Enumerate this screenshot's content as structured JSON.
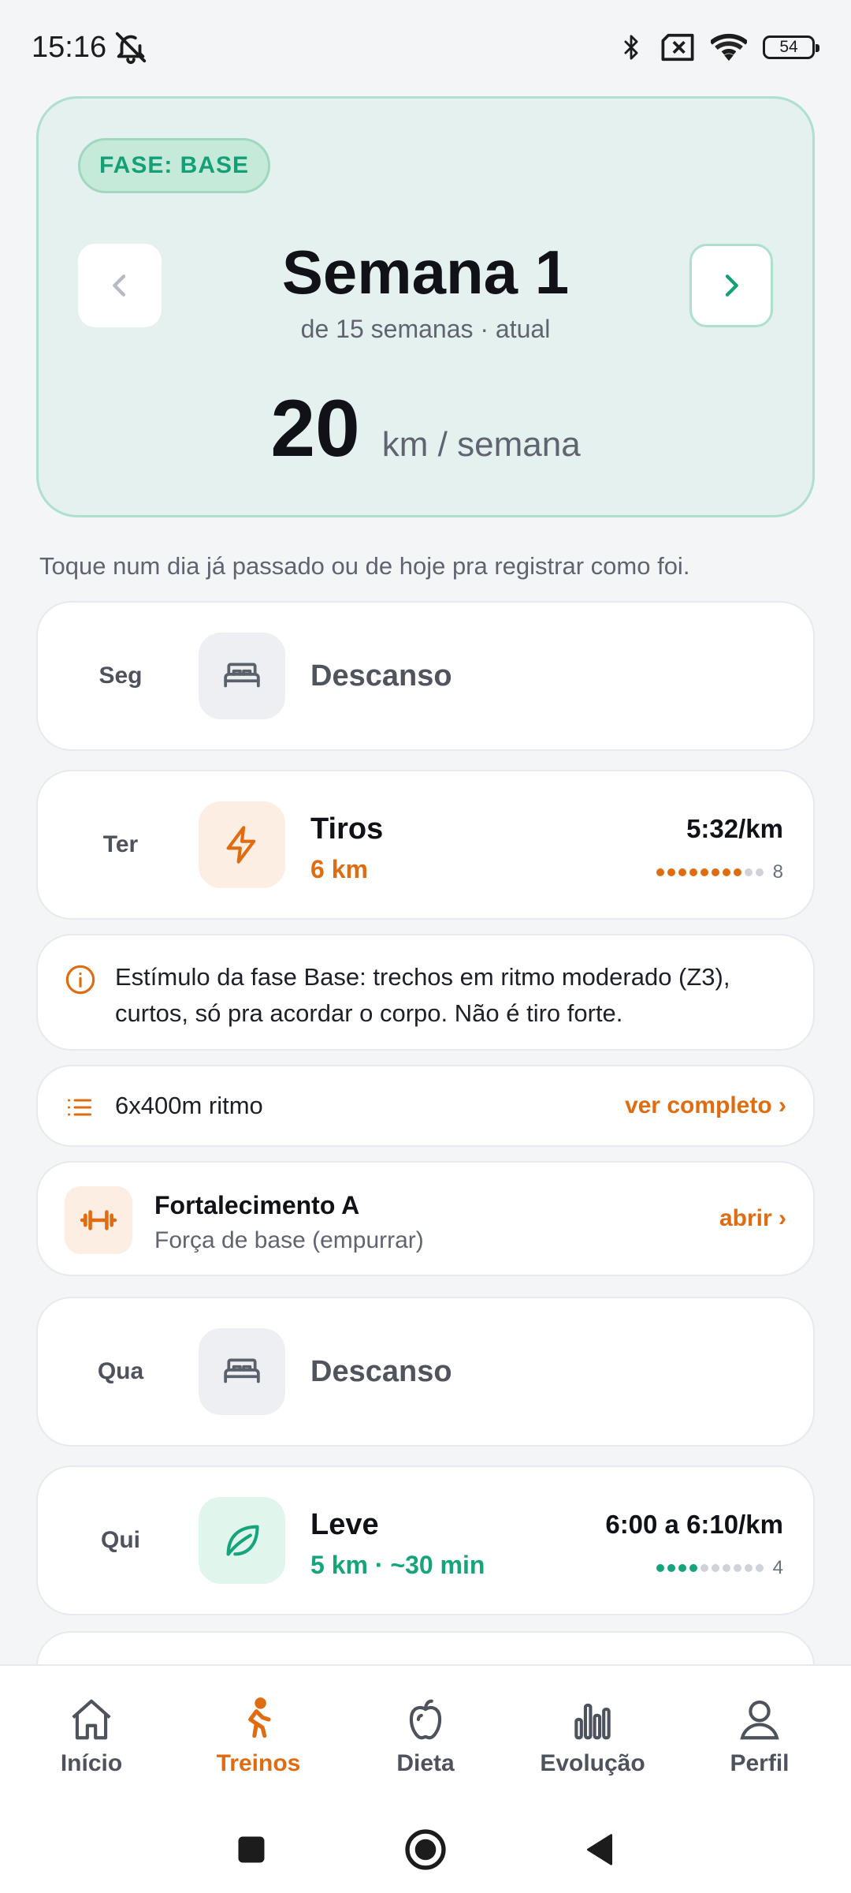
{
  "status_bar": {
    "time": "15:16",
    "battery": "54"
  },
  "phase_card": {
    "badge": "FASE: BASE",
    "week_title": "Semana 1",
    "week_subtitle": "de 15 semanas · atual",
    "km_value": "20",
    "km_unit": "km / semana"
  },
  "hint": "Toque num dia já passado ou de hoje pra registrar como foi.",
  "days": [
    {
      "day": "Seg",
      "type": "rest",
      "label": "Descanso"
    },
    {
      "day": "Ter",
      "type": "workout",
      "title": "Tiros",
      "subtitle": "6 km",
      "pace": "5:32/km",
      "intensity": 8,
      "intensity_max": 10,
      "intensity_label": "8",
      "color": "#e06c12"
    },
    {
      "day": "Qua",
      "type": "rest",
      "label": "Descanso"
    },
    {
      "day": "Qui",
      "type": "workout",
      "title": "Leve",
      "subtitle": "5 km · ~30 min",
      "pace": "6:00 a 6:10/km",
      "intensity": 4,
      "intensity_max": 10,
      "intensity_label": "4",
      "color": "#16a47b"
    }
  ],
  "info": {
    "line1": "Estímulo da fase Base: trechos em ritmo moderado (Z3),",
    "line2": "curtos, só pra acordar o corpo. Não é tiro forte."
  },
  "plan": {
    "text": "6x400m ritmo",
    "link": "ver completo ›"
  },
  "strength": {
    "title": "Fortalecimento A",
    "subtitle": "Força de base (empurrar)",
    "link": "abrir ›"
  },
  "nav": {
    "items": [
      {
        "label": "Início",
        "icon": "home-icon"
      },
      {
        "label": "Treinos",
        "icon": "runner-icon",
        "active": true
      },
      {
        "label": "Dieta",
        "icon": "apple-icon"
      },
      {
        "label": "Evolução",
        "icon": "bar-chart-icon"
      },
      {
        "label": "Perfil",
        "icon": "person-icon"
      }
    ]
  },
  "colors": {
    "accent_orange": "#e06c12",
    "accent_green": "#16a47b",
    "phase_bg": "#e4f1ef"
  }
}
